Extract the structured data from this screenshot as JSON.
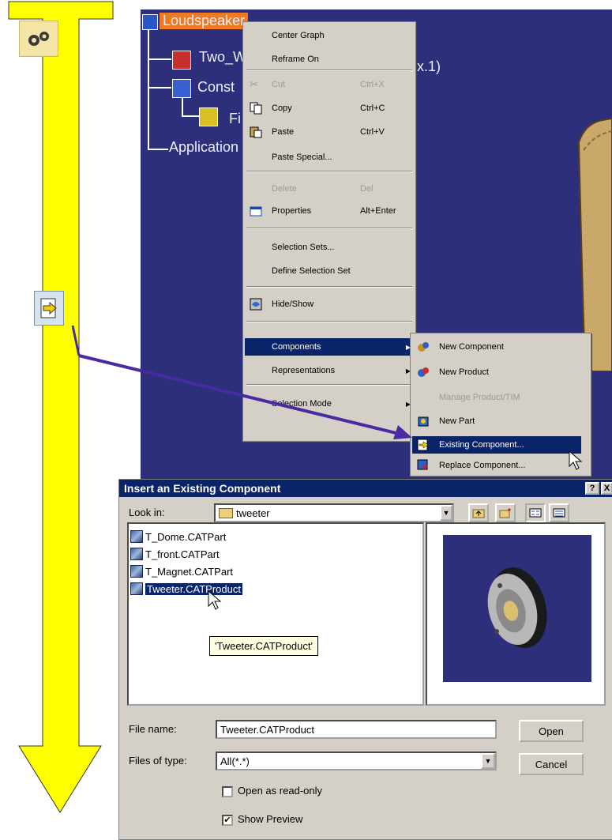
{
  "tree": {
    "root": "Loudspeaker",
    "child1": "Two_W",
    "child1_suffix": "x.1)",
    "child2": "Const",
    "child3": "Fi",
    "child4": "Application"
  },
  "context_menu": {
    "items": [
      {
        "label": "Center Graph",
        "shortcut": ""
      },
      {
        "label": "Reframe On",
        "shortcut": ""
      },
      {
        "label": "Cut",
        "shortcut": "Ctrl+X",
        "disabled": true
      },
      {
        "label": "Copy",
        "shortcut": "Ctrl+C"
      },
      {
        "label": "Paste",
        "shortcut": "Ctrl+V"
      },
      {
        "label": "Paste Special...",
        "shortcut": ""
      },
      {
        "label": "Delete",
        "shortcut": "Del",
        "disabled": true
      },
      {
        "label": "Properties",
        "shortcut": "Alt+Enter"
      },
      {
        "label": "Selection Sets...",
        "shortcut": ""
      },
      {
        "label": "Define Selection Set",
        "shortcut": ""
      },
      {
        "label": "Hide/Show",
        "shortcut": ""
      },
      {
        "label": "Components",
        "shortcut": ""
      },
      {
        "label": "Representations",
        "shortcut": ""
      },
      {
        "label": "Selection Mode",
        "shortcut": ""
      }
    ]
  },
  "submenu": {
    "items": [
      {
        "label": "New Component"
      },
      {
        "label": "New Product"
      },
      {
        "label": "Manage Product/TIM",
        "disabled": true
      },
      {
        "label": "New Part"
      },
      {
        "label": "Existing Component..."
      },
      {
        "label": "Replace Component..."
      }
    ]
  },
  "dialog": {
    "title": "Insert an Existing Component",
    "help_btn": "?",
    "close_btn": "X",
    "look_in_label": "Look in:",
    "look_in_value": "tweeter",
    "files": [
      "T_Dome.CATPart",
      "T_front.CATPart",
      "T_Magnet.CATPart",
      "Tweeter.CATProduct"
    ],
    "tooltip": "'Tweeter.CATProduct'",
    "file_name_label": "File name:",
    "file_name_value": "Tweeter.CATProduct",
    "files_of_type_label": "Files of type:",
    "files_of_type_value": "All(*.*)",
    "open_btn": "Open",
    "cancel_btn": "Cancel",
    "read_only_label": "Open as read-only",
    "show_preview_label": "Show Preview",
    "show_preview_check": "✔"
  },
  "colors": {
    "arrow_yellow": "#ffff00",
    "catia_bg": "#2d2f7a",
    "title_bar": "#0a246a",
    "highlight": "#0a246a",
    "pointer_line": "#4a2aa0"
  },
  "icons": [
    "gear-icon",
    "insert-component-icon",
    "folder-icon",
    "up-folder-icon",
    "new-folder-icon",
    "list-view-icon",
    "details-view-icon",
    "dropdown-arrow-icon",
    "submenu-arrow-icon",
    "mouse-cursor-icon"
  ]
}
